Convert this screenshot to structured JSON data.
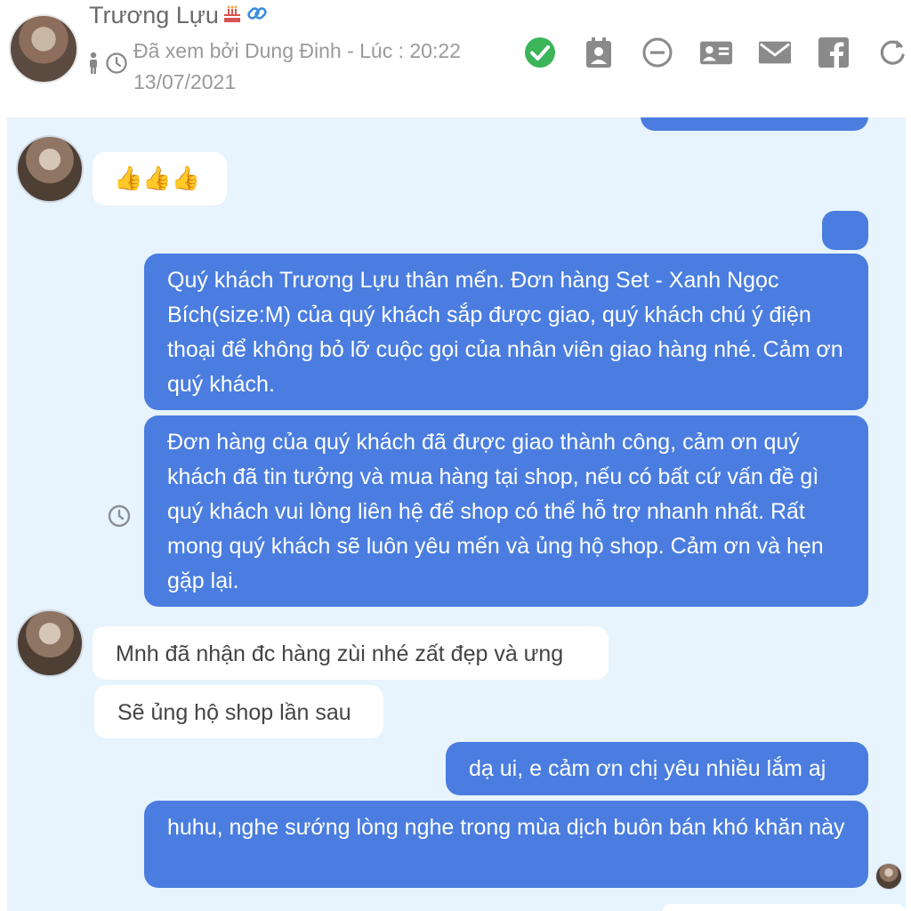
{
  "header": {
    "name": "Trương Lựu",
    "seen_line1": "Đã xem bởi Dung Đinh - Lúc : 20:22",
    "seen_line2": "13/07/2021",
    "icons": [
      "birthday-cake-icon",
      "link-icon",
      "person-icon",
      "clock-icon"
    ],
    "toolbar": [
      "check-circle-icon",
      "contact-icon",
      "minus-circle-icon",
      "id-card-icon",
      "mail-icon",
      "facebook-icon",
      "refresh-icon"
    ]
  },
  "colors": {
    "outgoing_bubble": "#4a7ddf",
    "incoming_bubble": "#ffffff",
    "chat_background": "#e7f3fd",
    "check_green": "#3cb55a"
  },
  "messages": [
    {
      "direction": "in",
      "text": "👍👍👍"
    },
    {
      "direction": "out",
      "text": ""
    },
    {
      "direction": "out",
      "text": "Quý khách Trương Lựu thân mến. Đơn hàng Set - Xanh Ngọc Bích(size:M) của quý khách sắp được giao, quý khách chú ý điện thoại để không bỏ lỡ cuộc gọi của nhân viên giao hàng nhé. Cảm ơn quý khách."
    },
    {
      "direction": "out",
      "text": "Đơn hàng của quý khách đã được giao thành công, cảm ơn quý khách đã tin tưởng và mua hàng tại shop, nếu có bất cứ vấn đề gì quý khách vui lòng liên hệ để shop có thể hỗ trợ nhanh nhất. Rất mong quý khách sẽ luôn yêu mến và ủng hộ shop. Cảm ơn và hẹn gặp lại."
    },
    {
      "direction": "in",
      "text": "Mnh đã nhận đc hàng zùi nhé zất đẹp và ưng"
    },
    {
      "direction": "in",
      "text": "Sẽ ủng hộ shop lần sau"
    },
    {
      "direction": "out",
      "text": "dạ ui, e cảm ơn chị yêu nhiều lắm aj"
    },
    {
      "direction": "out",
      "text": "huhu, nghe sướng lòng nghe trong mùa dịch buôn bán khó khăn này"
    }
  ]
}
